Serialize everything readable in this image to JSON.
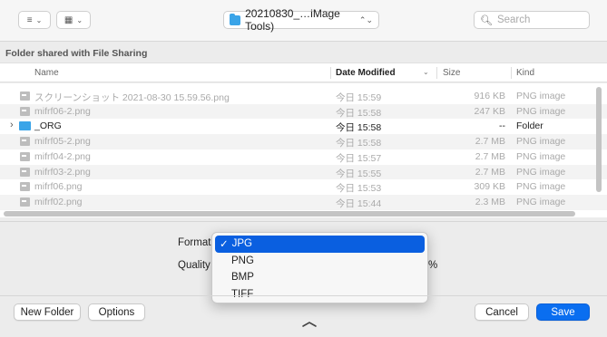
{
  "toolbar": {
    "view_icon_label": "≡",
    "group_icon_label": "▦",
    "location": "20210830_…iMage Tools)",
    "search_placeholder": "Search"
  },
  "section_title": "Folder shared with File Sharing",
  "columns": {
    "name": "Name",
    "date": "Date Modified",
    "size": "Size",
    "kind": "Kind"
  },
  "rows": [
    {
      "name": "スクリーンショット 2021-08-30 15.59.56.png",
      "date": "今日 15:59",
      "size": "916 KB",
      "kind": "PNG image"
    },
    {
      "name": "mifrf06-2.png",
      "date": "今日 15:58",
      "size": "247 KB",
      "kind": "PNG image"
    },
    {
      "name": "_ORG",
      "date": "今日 15:58",
      "size": "--",
      "kind": "Folder"
    },
    {
      "name": "mifrf05-2.png",
      "date": "今日 15:58",
      "size": "2.7 MB",
      "kind": "PNG image"
    },
    {
      "name": "mifrf04-2.png",
      "date": "今日 15:57",
      "size": "2.7 MB",
      "kind": "PNG image"
    },
    {
      "name": "mifrf03-2.png",
      "date": "今日 15:55",
      "size": "2.7 MB",
      "kind": "PNG image"
    },
    {
      "name": "mifrf06.png",
      "date": "今日 15:53",
      "size": "309 KB",
      "kind": "PNG image"
    },
    {
      "name": "mifrf02.png",
      "date": "今日 15:44",
      "size": "2.3 MB",
      "kind": "PNG image"
    }
  ],
  "accessory": {
    "format_label": "Format:",
    "quality_label": "Quality",
    "quality_suffix": "%"
  },
  "format_menu": {
    "check": "✓",
    "items": [
      "JPG",
      "PNG",
      "BMP",
      "TIFF"
    ]
  },
  "buttons": {
    "new_folder": "New Folder",
    "options": "Options",
    "cancel": "Cancel",
    "save": "Save"
  },
  "colors": {
    "accent": "#0a6ef0",
    "folder": "#3aa4e8"
  }
}
